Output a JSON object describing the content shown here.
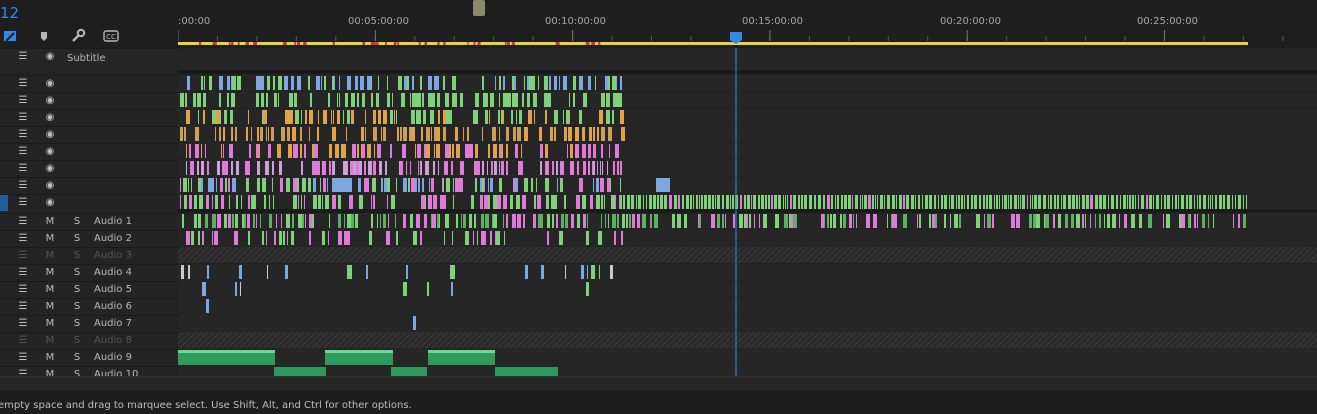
{
  "timecode": "12",
  "ruler": {
    "labels": [
      ":00:00",
      "00:05:00:00",
      "00:10:00:00",
      "00:15:00:00",
      "00:20:00:00",
      "00:25:00:00"
    ],
    "playhead_time": "00:14:03"
  },
  "subtitle_track": {
    "label": "Subtitle"
  },
  "video_track_count": 8,
  "audio_tracks": [
    {
      "label": "Audio 1",
      "m": "M",
      "s": "S",
      "enabled": true
    },
    {
      "label": "Audio 2",
      "m": "M",
      "s": "S",
      "enabled": true
    },
    {
      "label": "Audio 3",
      "m": "M",
      "s": "S",
      "enabled": false
    },
    {
      "label": "Audio 4",
      "m": "M",
      "s": "S",
      "enabled": true
    },
    {
      "label": "Audio 5",
      "m": "M",
      "s": "S",
      "enabled": true
    },
    {
      "label": "Audio 6",
      "m": "M",
      "s": "S",
      "enabled": true
    },
    {
      "label": "Audio 7",
      "m": "M",
      "s": "S",
      "enabled": true
    },
    {
      "label": "Audio 8",
      "m": "M",
      "s": "S",
      "enabled": false
    },
    {
      "label": "Audio 9",
      "m": "M",
      "s": "S",
      "enabled": true
    },
    {
      "label": "Audio 10",
      "m": "M",
      "s": "S",
      "enabled": true
    }
  ],
  "status_text": "empty space and drag to marquee select. Use Shift, Alt, and Ctrl for other options.",
  "colors": {
    "accent": "#2d8ceb",
    "work_area": "#e8d33a",
    "video_green": "#7fd27a",
    "video_pink": "#e07ad8",
    "video_orange": "#e0a24a",
    "video_blue": "#7ea6e0",
    "audio_green": "#2f9a5a"
  }
}
